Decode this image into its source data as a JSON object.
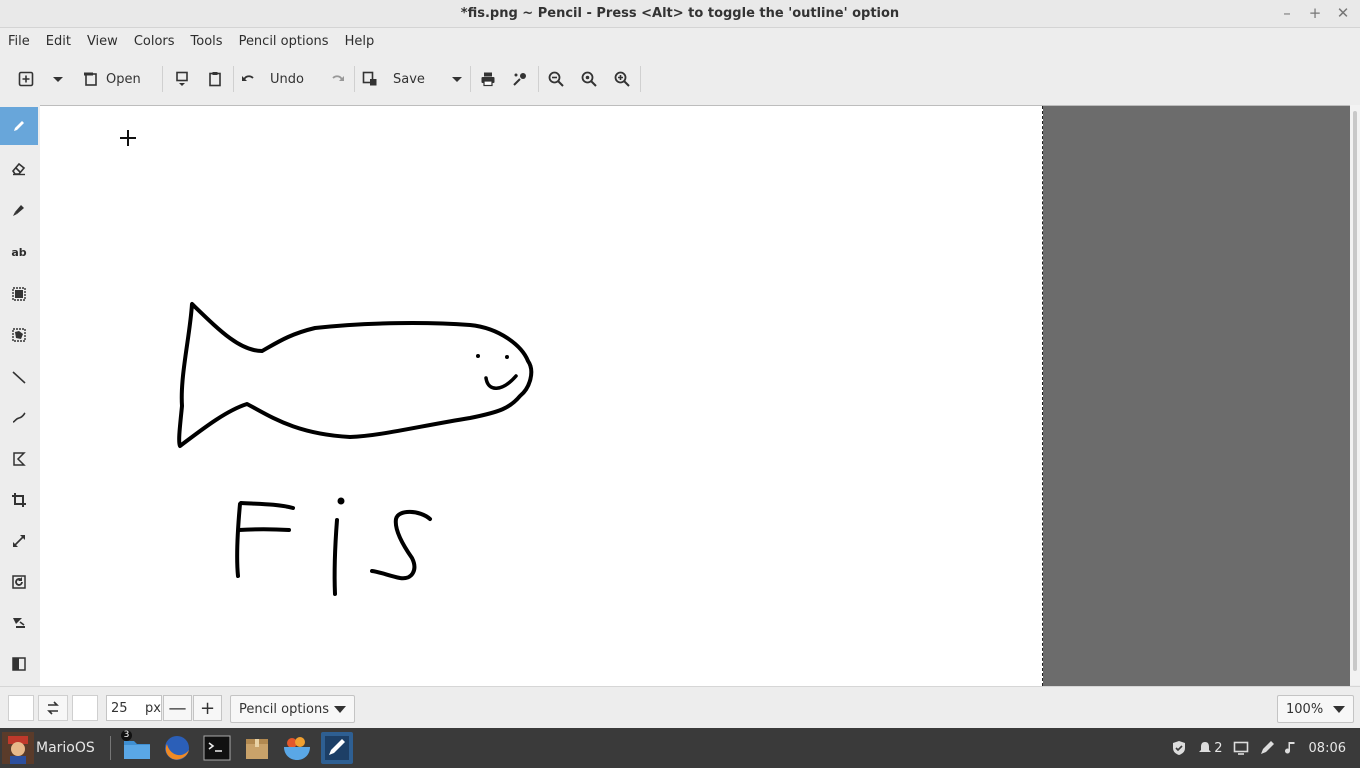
{
  "window": {
    "title": "*fis.png ~ Pencil - Press <Alt> to toggle the 'outline' option",
    "controls": {
      "minimize": "–",
      "maximize": "+",
      "close": "✕"
    }
  },
  "menu": [
    "File",
    "Edit",
    "View",
    "Colors",
    "Tools",
    "Pencil options",
    "Help"
  ],
  "toolbar": {
    "open_label": "Open",
    "undo_label": "Undo",
    "save_label": "Save"
  },
  "tools": [
    {
      "name": "pencil",
      "active": true
    },
    {
      "name": "eraser"
    },
    {
      "name": "highlighter"
    },
    {
      "name": "text",
      "label": "ab"
    },
    {
      "name": "rect-selection"
    },
    {
      "name": "free-selection"
    },
    {
      "name": "line"
    },
    {
      "name": "curve"
    },
    {
      "name": "shape"
    },
    {
      "name": "crop"
    },
    {
      "name": "scale"
    },
    {
      "name": "rotate"
    },
    {
      "name": "filters"
    },
    {
      "name": "skew"
    }
  ],
  "bottombar": {
    "size_value": "25",
    "size_unit": "px",
    "minus": "—",
    "plus": "+",
    "options_label": "Pencil options",
    "zoom_value": "100%"
  },
  "taskbar": {
    "start_label": "MarioOS",
    "files_badge": "3",
    "notifications_count": "2",
    "clock": "08:06"
  }
}
